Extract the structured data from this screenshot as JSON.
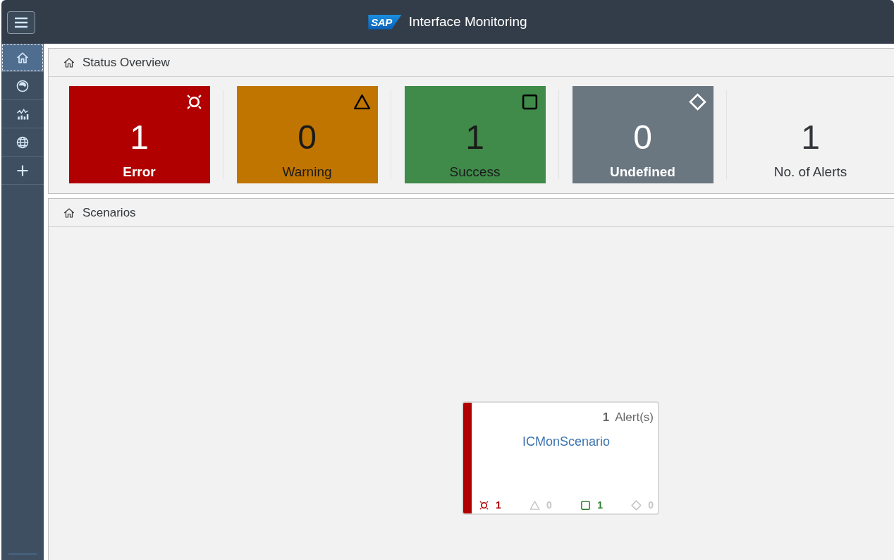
{
  "header": {
    "logo": "SAP",
    "title": "Interface Monitoring"
  },
  "sidebar": {
    "items": [
      {
        "kind": "home",
        "selected": true
      },
      {
        "kind": "gauge",
        "selected": false
      },
      {
        "kind": "chart",
        "selected": false
      },
      {
        "kind": "globe",
        "selected": false
      },
      {
        "kind": "plus",
        "selected": false
      }
    ]
  },
  "status_overview": {
    "title": "Status Overview",
    "tiles": [
      {
        "kind": "error",
        "value": "1",
        "label": "Error"
      },
      {
        "kind": "warning",
        "value": "0",
        "label": "Warning"
      },
      {
        "kind": "success",
        "value": "1",
        "label": "Success"
      },
      {
        "kind": "undefined",
        "value": "0",
        "label": "Undefined"
      },
      {
        "kind": "total",
        "value": "1",
        "label": "No. of Alerts"
      }
    ]
  },
  "scenarios": {
    "title": "Scenarios",
    "cards": [
      {
        "alert_count": "1",
        "alert_label": "Alert(s)",
        "name": "ICMonScenario",
        "kind": "error",
        "counts": [
          {
            "kind": "error",
            "value": "1"
          },
          {
            "kind": "warning",
            "value": "0"
          },
          {
            "kind": "success",
            "value": "1"
          },
          {
            "kind": "undefined",
            "value": "0"
          }
        ]
      }
    ]
  }
}
